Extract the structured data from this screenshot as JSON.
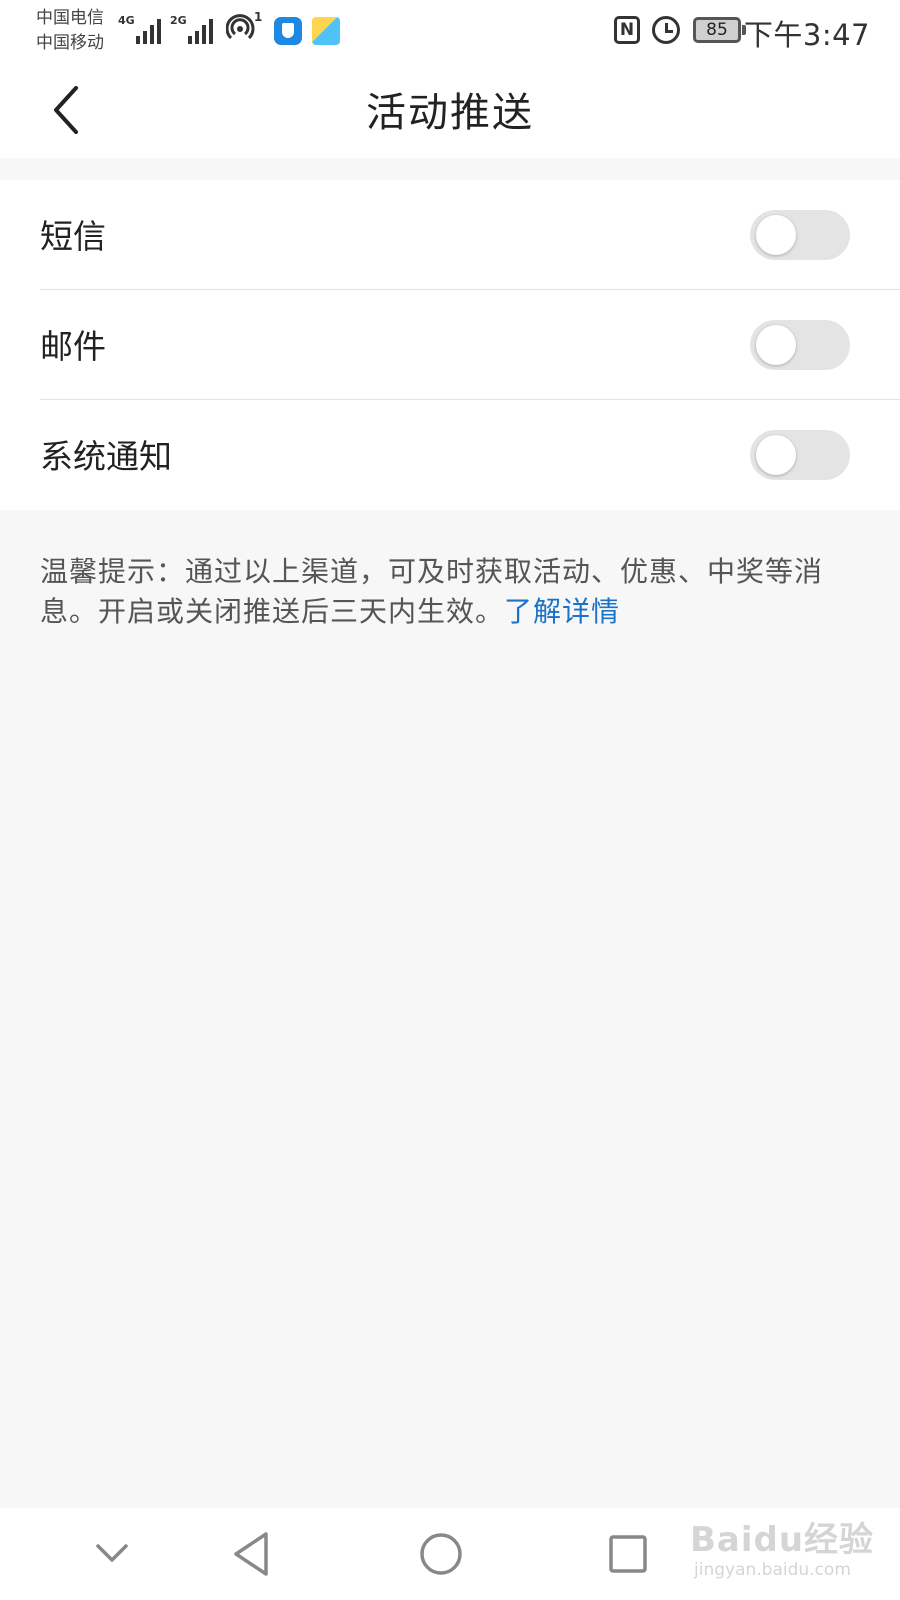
{
  "status_bar": {
    "carrier_1": "中国电信",
    "carrier_2": "中国移动",
    "network_1": "4G",
    "network_2": "2G",
    "hotspot_count": "1",
    "battery": "85",
    "time": "下午3:47",
    "icons": [
      "signal-icon",
      "hotspot-icon",
      "security-app-icon",
      "app-tile-icon",
      "nfc-icon",
      "alarm-icon",
      "battery-icon"
    ]
  },
  "header": {
    "title": "活动推送",
    "back_icon": "chevron-left-icon"
  },
  "settings": [
    {
      "label": "短信",
      "enabled": false
    },
    {
      "label": "邮件",
      "enabled": false
    },
    {
      "label": "系统通知",
      "enabled": false
    }
  ],
  "tip": {
    "text": "温馨提示：通过以上渠道，可及时获取活动、优惠、中奖等消息。开启或关闭推送后三天内生效。",
    "link": "了解详情"
  },
  "nav_bar": {
    "icons": [
      "collapse-chevron-icon",
      "back-triangle-icon",
      "home-circle-icon",
      "recents-square-icon"
    ]
  },
  "watermark": {
    "main": "Baidu经验",
    "sub": "jingyan.baidu.com"
  },
  "colors": {
    "page_background": "#f7f7f7",
    "toggle_off": "#e4e4e4",
    "link": "#1a73c9"
  }
}
